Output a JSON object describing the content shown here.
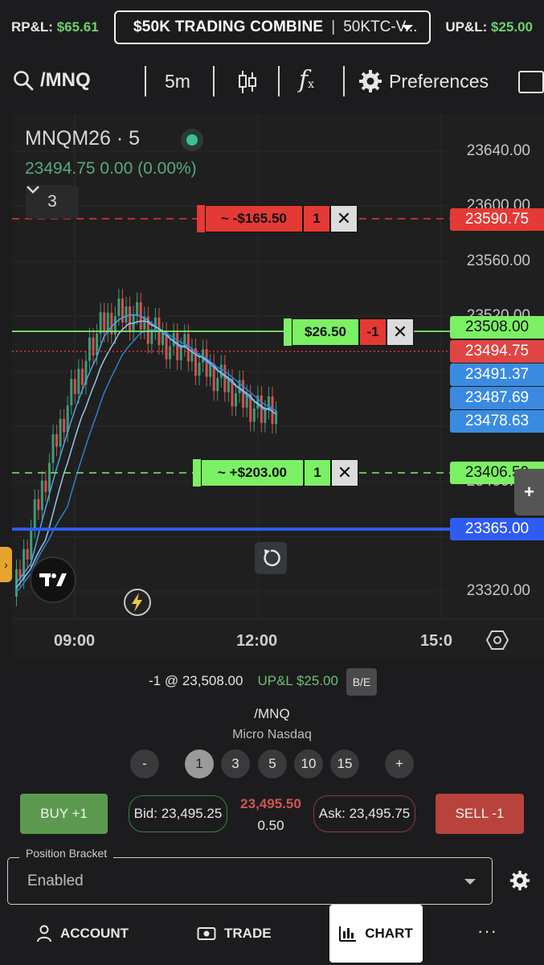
{
  "header": {
    "rpl_label": "RP&L:",
    "rpl_value": "$65.61",
    "account_name": "$50K TRADING COMBINE",
    "account_sep": "|",
    "account_id": "50KTC-V...",
    "upl_label": "UP&L:",
    "upl_value": "$25.00"
  },
  "toolbar": {
    "symbol": "/MNQ",
    "interval": "5m",
    "fx_label": "f",
    "fx_sub": "x",
    "preferences_label": "Preferences"
  },
  "chart": {
    "symbol_title": "MNQM26 · 5",
    "quote": "23494.75  0.00 (0.00%)",
    "studies_count": "3",
    "price_ticks": [
      "23640.00",
      "23600.00",
      "23560.00",
      "23520.00",
      "23400.00",
      "23360.00",
      "23320.00"
    ],
    "time_ticks": [
      "09:00",
      "12:00",
      "15:0"
    ],
    "price_tags": {
      "stop": "23590.75",
      "position": "23508.00",
      "last": "23494.75",
      "ma1": "23491.37",
      "ma2": "23487.69",
      "ma3": "23478.63",
      "target": "23406.50",
      "level": "23365.00"
    },
    "orders": {
      "stop_pl": "~ -$165.50",
      "stop_qty": "1",
      "position_pl": "$26.50",
      "position_qty": "-1",
      "target_pl": "~ +$203.00",
      "target_qty": "1",
      "close_glyph": "✕"
    },
    "plus": "+",
    "handle": "›"
  },
  "position": {
    "summary": "-1 @ 23,508.00",
    "upl": "UP&L $25.00",
    "be_label": "B/E",
    "symbol": "/MNQ",
    "description": "Micro Nasdaq",
    "qty_buttons": [
      "-",
      "1",
      "3",
      "5",
      "10",
      "15",
      "+"
    ],
    "selected_qty": "1"
  },
  "trade": {
    "buy_label": "BUY +1",
    "bid": "Bid: 23,495.25",
    "last": "23,495.50",
    "spread": "0.50",
    "ask": "Ask: 23,495.75",
    "sell_label": "SELL -1"
  },
  "bracket": {
    "label": "Position Bracket",
    "value": "Enabled"
  },
  "nav": {
    "account": "ACCOUNT",
    "trade": "TRADE",
    "chart": "CHART",
    "more": "···"
  },
  "colors": {
    "up": "#3e9b78",
    "down": "#d64f4f",
    "target_green": "#7cf064",
    "stop_red": "#e53935",
    "level_blue": "#2f5cf0",
    "ma_blue": "#4da3e6"
  }
}
